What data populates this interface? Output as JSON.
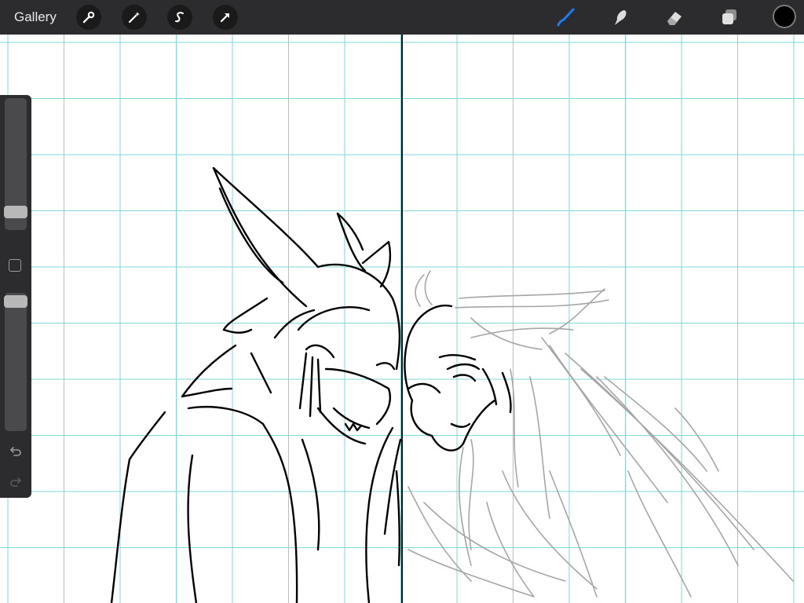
{
  "toolbar": {
    "gallery_label": "Gallery",
    "actions_icon": "wrench-icon",
    "adjustments_icon": "magic-wand-icon",
    "selection_icon": "selection-s-icon",
    "transform_icon": "arrow-cursor-icon",
    "brush_icon": "brush-icon",
    "smudge_icon": "smudge-icon",
    "eraser_icon": "eraser-icon",
    "layers_icon": "layers-icon",
    "current_color": "#000000",
    "active_tool_color": "#1e7bf0"
  },
  "sidebar": {
    "brush_size_level": 0.1,
    "opacity_level": 0.98,
    "undo_icon": "undo-icon",
    "redo_icon": "redo-icon"
  },
  "canvas": {
    "grid_color": "#7fd8d4",
    "background": "#ffffff"
  }
}
